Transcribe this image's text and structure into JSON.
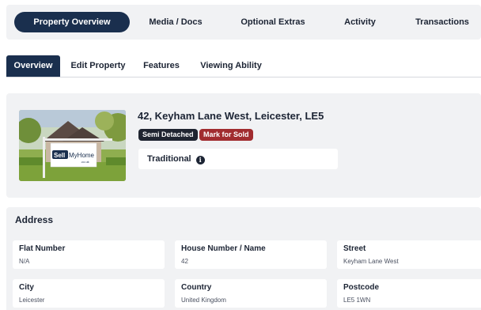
{
  "top_tabs": [
    {
      "label": "Property Overview",
      "active": true
    },
    {
      "label": "Media / Docs",
      "active": false
    },
    {
      "label": "Optional Extras",
      "active": false
    },
    {
      "label": "Activity",
      "active": false
    },
    {
      "label": "Transactions",
      "active": false
    }
  ],
  "sub_tabs": [
    {
      "label": "Overview",
      "active": true
    },
    {
      "label": "Edit Property",
      "active": false
    },
    {
      "label": "Features",
      "active": false
    },
    {
      "label": "Viewing Ability",
      "active": false
    }
  ],
  "property": {
    "address_title": "42, Keyham Lane West, Leicester, LE5",
    "badges": [
      "Semi Detached",
      "Mark for Sold"
    ],
    "style": "Traditional",
    "info_icon": "i",
    "sign_brand_left": "Sell",
    "sign_brand_right": "MyHome",
    "sign_brand_tld": ".co.uk"
  },
  "address": {
    "heading": "Address",
    "fields": [
      {
        "label": "Flat Number",
        "value": "N/A"
      },
      {
        "label": "House Number / Name",
        "value": "42"
      },
      {
        "label": "Street",
        "value": "Keyham Lane West"
      },
      {
        "label": "City",
        "value": "Leicester"
      },
      {
        "label": "Country",
        "value": "United Kingdom"
      },
      {
        "label": "Postcode",
        "value": "LE5 1WN"
      }
    ]
  },
  "colors": {
    "primary": "#1a2f4e",
    "danger": "#a12c2f",
    "panel": "#f1f2f4"
  }
}
